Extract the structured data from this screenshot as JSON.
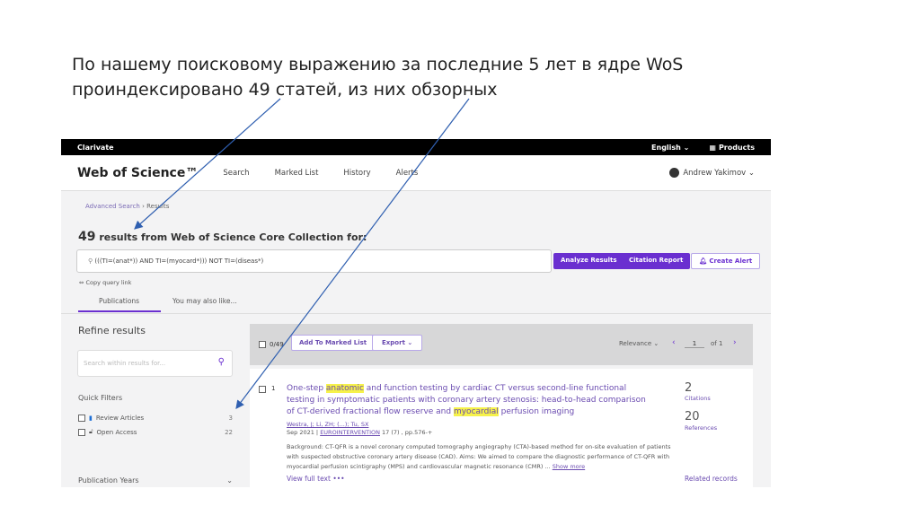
{
  "caption": {
    "line1": "По нашему поисковому выражению за последние 5 лет в ядре WoS",
    "line2": "проиндексировано 49 статей, из них обзорных"
  },
  "topbar": {
    "brand": "Clarivate",
    "language": "English ⌄",
    "products": "Products"
  },
  "header": {
    "logo": "Web of Science™",
    "nav": [
      "Search",
      "Marked List",
      "History",
      "Alerts"
    ],
    "user": "Andrew Yakimov ⌄"
  },
  "breadcrumb": {
    "parent": "Advanced Search",
    "sep": " › ",
    "current": "Results"
  },
  "results": {
    "count": "49",
    "title": " results from Web of Science Core Collection for:",
    "query": "(((TI=(anat*)) AND TI=(myocard*))) NOT TI=(diseas*)",
    "copy_link": "⇔ Copy query link"
  },
  "buttons": {
    "analyze": "Analyze Results",
    "citation": "Citation Report",
    "alert": "Create Alert"
  },
  "tabs": [
    "Publications",
    "You may also like..."
  ],
  "sidebar": {
    "title": "Refine results",
    "search_placeholder": "Search within results for...",
    "quick_filters": "Quick Filters",
    "filters": [
      {
        "label": "Review Articles",
        "count": "3"
      },
      {
        "label": "Open Access",
        "count": "22"
      }
    ],
    "pub_years": "Publication Years"
  },
  "toolbar": {
    "selected": "0/49",
    "add": "Add To Marked List",
    "export": "Export ⌄",
    "sort": "Relevance ⌄",
    "page": "1",
    "of": "of 1"
  },
  "record": {
    "index": "1",
    "title_a": "One-step ",
    "hl1": "anatomic",
    "title_b": " and function testing by cardiac CT versus second-line functional testing in symptomatic patients with coronary artery stenosis: head-to-head comparison of CT-derived fractional flow reserve and ",
    "hl2": "myocardial",
    "title_c": " perfusion imaging",
    "authors": "Westra, J; Li, ZH; (...); Tu, SX",
    "date": "Sep 2021 | ",
    "journal": "EUROINTERVENTION",
    "vol": " 17 (7) , pp.576-+",
    "abstract": "Background: CT-QFR is a novel coronary computed tomography angiography (CTA)-based method for on-site evaluation of patients with suspected obstructive coronary artery disease (CAD). Aims: We aimed to compare the diagnostic performance of CT-QFR with myocardial perfusion scintigraphy (MPS) and cardiovascular magnetic resonance (CMR) ... ",
    "show_more": "Show more",
    "full_text": "View full text  •••",
    "citations": "2",
    "citations_label": "Citations",
    "references": "20",
    "references_label": "References",
    "related": "Related records"
  }
}
